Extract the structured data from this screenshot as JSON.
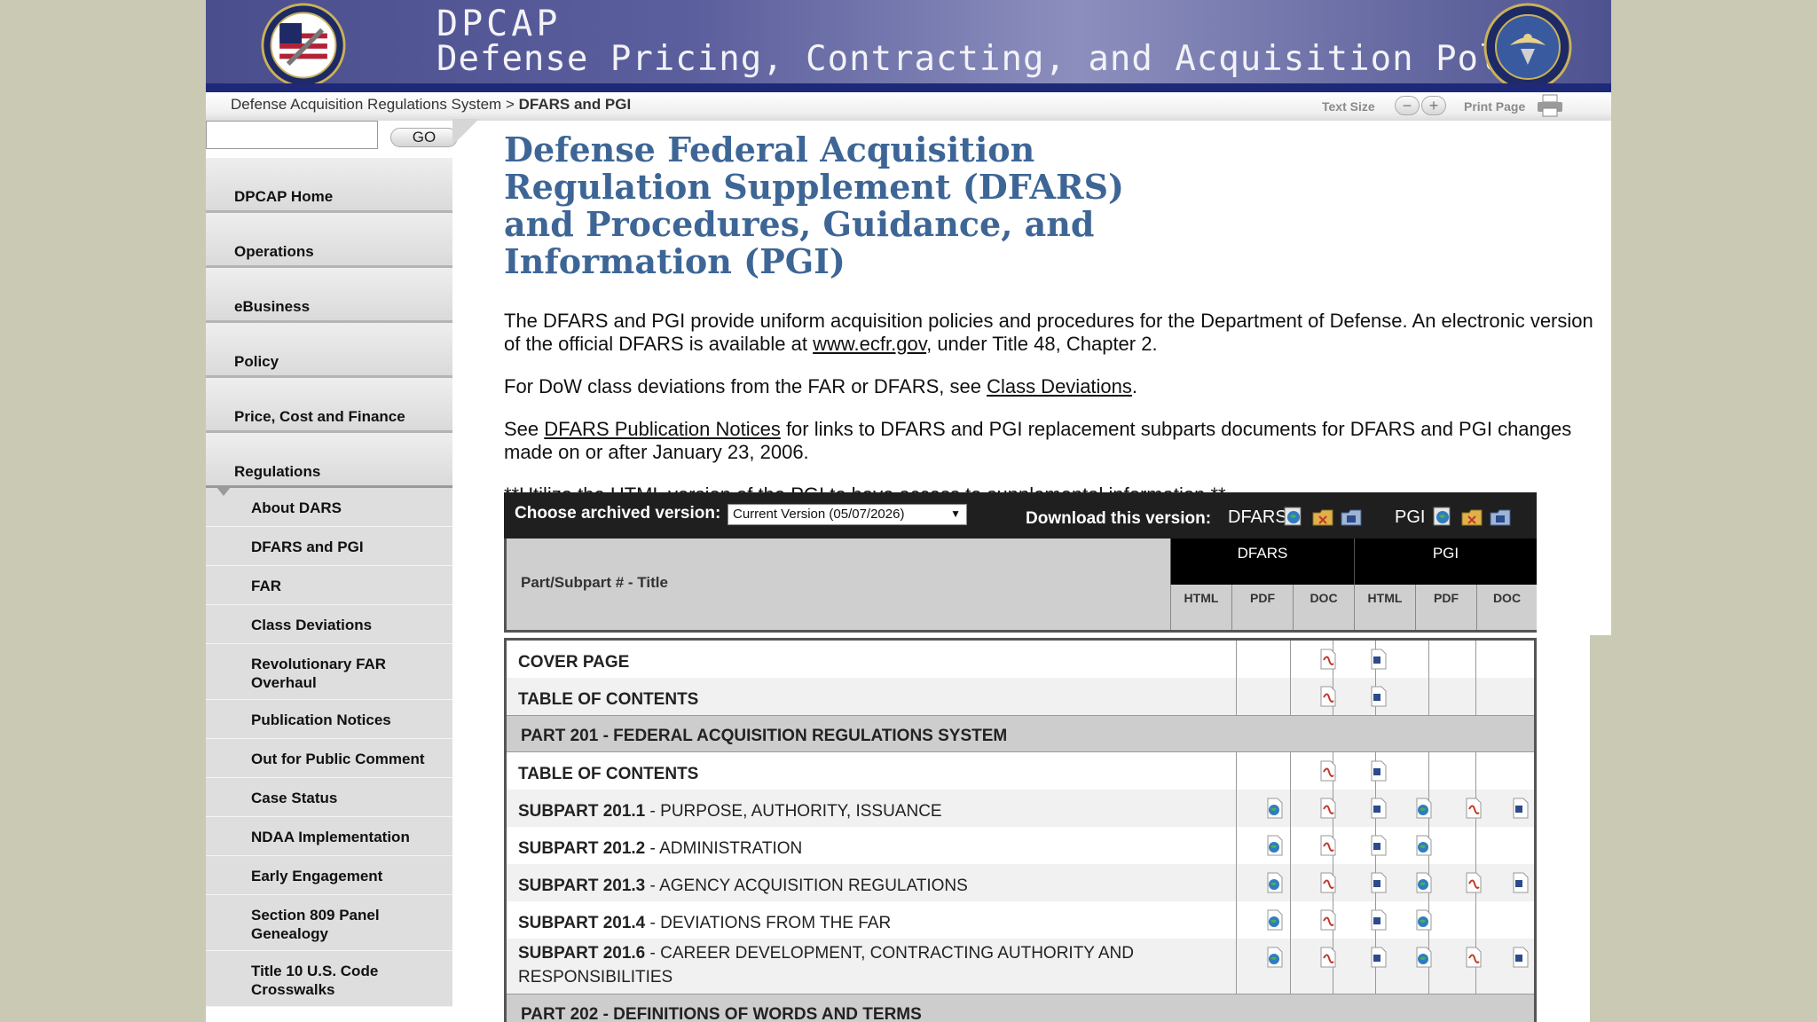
{
  "header": {
    "site_abbr": "DPCAP",
    "site_title": "Defense Pricing, Contracting, and Acquisition Policy"
  },
  "breadcrumb": {
    "parent": "Defense Acquisition Regulations System",
    "separator": ">",
    "current": "DFARS and PGI"
  },
  "toolbar": {
    "text_size_label": "Text Size",
    "decrease_label": "−",
    "increase_label": "+",
    "print_label": "Print Page"
  },
  "search": {
    "go_label": "GO"
  },
  "sidebar": {
    "main_items": [
      {
        "label": "DPCAP Home"
      },
      {
        "label": "Operations"
      },
      {
        "label": "eBusiness"
      },
      {
        "label": "Policy"
      },
      {
        "label": "Price, Cost and Finance"
      },
      {
        "label": "Regulations"
      }
    ],
    "sub_items": [
      {
        "label": "About DARS"
      },
      {
        "label": "DFARS and PGI"
      },
      {
        "label": "FAR"
      },
      {
        "label": "Class Deviations"
      },
      {
        "label": "Revolutionary FAR Overhaul"
      },
      {
        "label": "Publication Notices"
      },
      {
        "label": "Out for Public Comment"
      },
      {
        "label": "Case Status"
      },
      {
        "label": "NDAA Implementation"
      },
      {
        "label": "Early Engagement"
      },
      {
        "label": "Section 809 Panel Genealogy"
      },
      {
        "label": "Title 10 U.S. Code Crosswalks"
      }
    ]
  },
  "main": {
    "title": "Defense Federal Acquisition Regulation Supplement (DFARS) and Procedures, Guidance, and Information (PGI)",
    "p1_a": "The DFARS and PGI provide uniform acquisition policies and procedures for the Department of Defense. An electronic version of the official DFARS is available at ",
    "p1_link": "www.ecfr.gov",
    "p1_b": ", under Title 48, Chapter 2.",
    "p2_a": "For DoW class deviations from the FAR or DFARS, see ",
    "p2_link": "Class Deviations",
    "p2_b": ".",
    "p3_a": "See ",
    "p3_link": "DFARS Publication Notices",
    "p3_b": " for links to DFARS and PGI replacement subparts documents for DFARS and PGI changes made on or after January 23, 2006.",
    "p4": "**Utilize the HTML version of the PGI to have access to supplemental information.**"
  },
  "archive": {
    "choose_label": "Choose archived version:",
    "selected_version": "Current Version (05/07/2026)",
    "download_label": "Download this version:",
    "dfars_label": "DFARS",
    "pgi_label": "PGI",
    "col_title": "Part/Subpart # - Title",
    "group_dfars": "DFARS",
    "group_pgi": "PGI",
    "sub_cols": [
      "HTML",
      "PDF",
      "DOC",
      "HTML",
      "PDF",
      "DOC"
    ]
  },
  "rows": [
    {
      "kind": "row",
      "num": "",
      "title": "COVER PAGE",
      "bold_all": true
    },
    {
      "kind": "row",
      "num": "",
      "title": "TABLE OF CONTENTS",
      "bold_all": true
    },
    {
      "kind": "part",
      "title": "PART 201 - FEDERAL ACQUISITION REGULATIONS SYSTEM"
    },
    {
      "kind": "row",
      "num": "",
      "title": "TABLE OF CONTENTS",
      "bold_all": true
    },
    {
      "kind": "row",
      "num": "SUBPART 201.1",
      "title": " - PURPOSE, AUTHORITY, ISSUANCE"
    },
    {
      "kind": "row",
      "num": "SUBPART 201.2",
      "title": " - ADMINISTRATION"
    },
    {
      "kind": "row",
      "num": "SUBPART 201.3",
      "title": " - AGENCY ACQUISITION REGULATIONS"
    },
    {
      "kind": "row",
      "num": "SUBPART 201.4",
      "title": " - DEVIATIONS FROM THE FAR"
    },
    {
      "kind": "row",
      "num": "SUBPART 201.6",
      "title": " - CAREER DEVELOPMENT, CONTRACTING AUTHORITY AND RESPONSIBILITIES"
    },
    {
      "kind": "part",
      "title": "PART 202 - DEFINITIONS OF WORDS AND TERMS"
    }
  ]
}
